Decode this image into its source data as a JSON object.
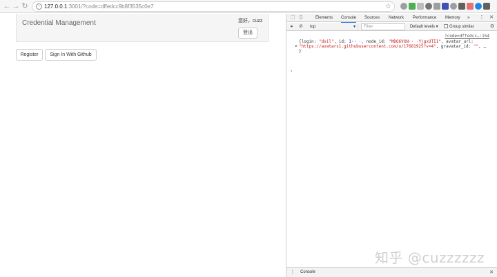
{
  "browser": {
    "back_icon": "back-arrow-icon",
    "forward_icon": "forward-arrow-icon",
    "reload_icon": "reload-icon",
    "url_host": "127.0.0.1",
    "url_rest": ":3001/?code=dffedcc9b8f",
    "url_rest_2": "3535c0e7",
    "bookmark_icon": "star-icon",
    "extension_colors": [
      "#9e9e9e",
      "#4caf50",
      "#bdbdbd",
      "#757575",
      "#9e9e9e",
      "#3f51b5",
      "#9e9e9e",
      "#616161",
      "#e57373",
      "#1e88e5",
      "#616161"
    ]
  },
  "page": {
    "brand": "Credential Management",
    "greeting": "您好，cuzz",
    "logout_label": "登出",
    "register_label": "Register",
    "github_label": "Sign In With Github"
  },
  "devtools": {
    "tabs": [
      "Elements",
      "Console",
      "Sources",
      "Network",
      "Performance",
      "Memory"
    ],
    "more": "»",
    "active_tab": "Console",
    "context": "top",
    "filter_placeholder": "Filter",
    "levels": "Default levels ▾",
    "group_similar": "Group similar",
    "log_source": "?code=dffedcc…:154",
    "log_line1_a": "{login: ",
    "log_line1_login": "\"dxil\"",
    "log_line1_b": ", id: ",
    "log_line1_id": "1·· ·",
    "log_line1_c": ", node_id: ",
    "log_line1_node": "\"MDQ6VXN·· ·YjgxOTI1\"",
    "log_line1_d": ", avatar_url:",
    "log_line2_url": "\"https://avatars1.githubusercontent.com/u/17681925?v=4\"",
    "log_line2_b": ", gravatar_id: ",
    "log_line2_grav": "\"\"",
    "log_line2_c": ", …",
    "log_line3": "}",
    "prompt": "›",
    "drawer_label": "Console"
  },
  "watermark": "知乎 @cuzzzzzz"
}
